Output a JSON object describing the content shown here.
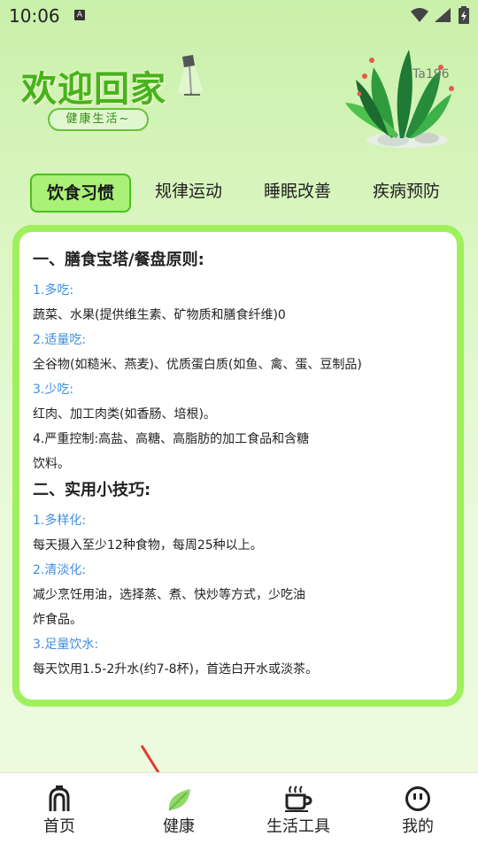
{
  "status_bar": {
    "time": "10:06",
    "notification_icon": "A"
  },
  "header": {
    "title": "欢迎回家",
    "subtitle": "健康生活~",
    "decor_label": "Ta196",
    "accent_color": "#46b31b"
  },
  "tabs": [
    {
      "label": "饮食习惯",
      "active": true
    },
    {
      "label": "规律运动",
      "active": false
    },
    {
      "label": "睡眠改善",
      "active": false
    },
    {
      "label": "疾病预防",
      "active": false
    }
  ],
  "content": {
    "section1": {
      "title": "一、膳食宝塔/餐盘原则:",
      "item1_head": "1.多吃:",
      "item1_text": "蔬菜、水果(提供维生素、矿物质和膳食纤维)0",
      "item2_head": "2.适量吃:",
      "item2_text": "全谷物(如糙米、燕麦)、优质蛋白质(如鱼、禽、蛋、豆制品)",
      "item3_head": "3.少吃:",
      "item3_text": "红肉、加工肉类(如香肠、培根)。",
      "item4_line1": "4.严重控制:高盐、高糖、高脂肪的加工食品和含糖",
      "item4_line2": "饮料。"
    },
    "section2": {
      "title": "二、实用小技巧:",
      "item1_head": "1.多样化:",
      "item1_text": "每天摄入至少12种食物，每周25种以上。",
      "item2_head": "2.清淡化:",
      "item2_line1": "减少烹饪用油，选择蒸、煮、快炒等方式，少吃油",
      "item2_line2": "炸食品。",
      "item3_head": "3.足量饮水:",
      "item3_text": "每天饮用1.5-2升水(约7-8杯)，首选白开水或淡茶。"
    },
    "link_color": "#3d8fe0"
  },
  "bottom_nav": [
    {
      "label": "首页",
      "icon": "home-icon"
    },
    {
      "label": "健康",
      "icon": "leaf-icon"
    },
    {
      "label": "生活工具",
      "icon": "coffee-cup-icon"
    },
    {
      "label": "我的",
      "icon": "face-icon"
    }
  ]
}
